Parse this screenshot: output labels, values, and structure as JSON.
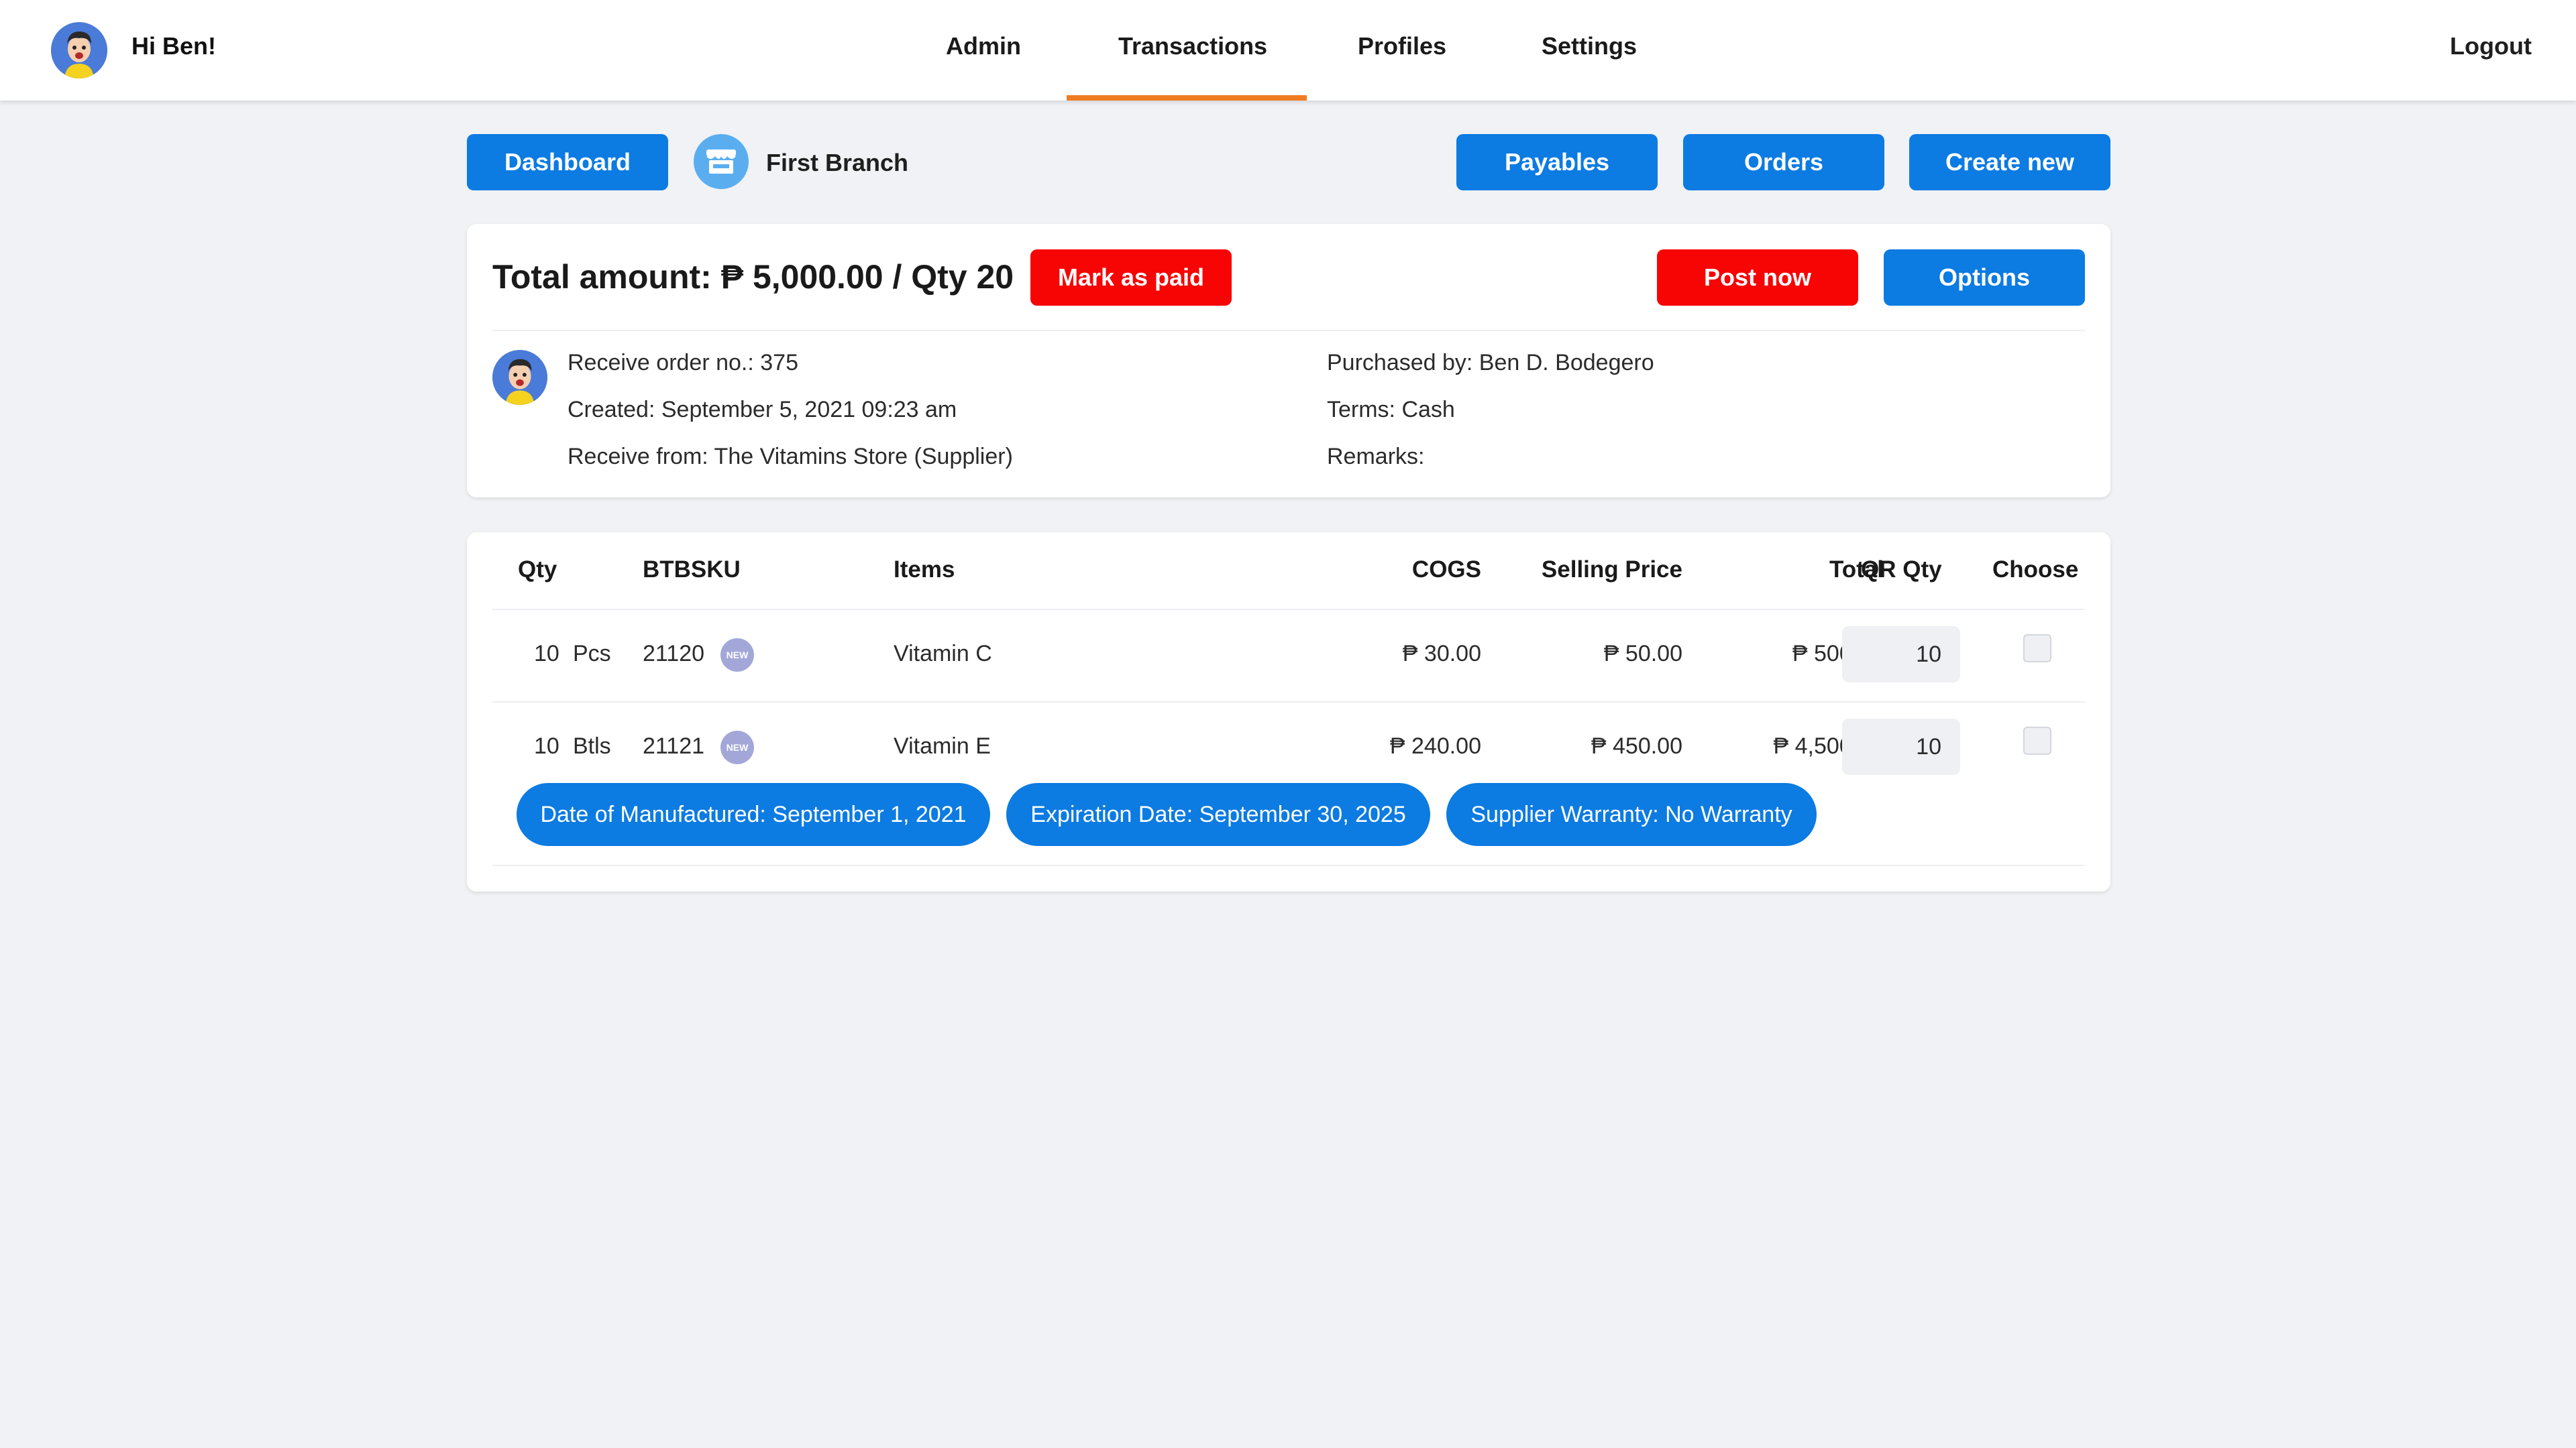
{
  "header": {
    "greeting": "Hi Ben!",
    "nav": [
      "Admin",
      "Transactions",
      "Profiles",
      "Settings"
    ],
    "active_nav": "Transactions",
    "logout": "Logout",
    "active_color": "#f07d22"
  },
  "toolbar": {
    "dashboard": "Dashboard",
    "branch": "First Branch",
    "payables": "Payables",
    "orders": "Orders",
    "create_new": "Create new"
  },
  "summary": {
    "total": "Total amount: ₱ 5,000.00 / Qty 20",
    "mark_paid": "Mark as paid",
    "post_now": "Post now",
    "options": "Options",
    "receive_order": "Receive order no.: 375",
    "created": "Created: September 5, 2021 09:23 am",
    "receive_from": "Receive from: The Vitamins Store (Supplier)",
    "purchased_by": "Purchased by: Ben D. Bodegero",
    "terms": "Terms: Cash",
    "remarks": "Remarks:"
  },
  "table": {
    "headers": [
      "Qty",
      "BTBSKU",
      "Items",
      "COGS",
      "Selling Price",
      "Total",
      "QR Qty",
      "Choose"
    ],
    "rows": [
      {
        "qty": "10",
        "unit": "Pcs",
        "sku": "21120",
        "badge": "NEW",
        "item": "Vitamin C",
        "cogs": "₱ 30.00",
        "price": "₱ 50.00",
        "total": "₱ 500.00",
        "qr_qty": "10"
      },
      {
        "qty": "10",
        "unit": "Btls",
        "sku": "21121",
        "badge": "NEW",
        "item": "Vitamin E",
        "cogs": "₱ 240.00",
        "price": "₱ 450.00",
        "total": "₱ 4,500.00",
        "qr_qty": "10"
      }
    ],
    "details": [
      "Date of Manufactured: September 1, 2021",
      "Expiration Date: September 30, 2025",
      "Supplier Warranty: No Warranty"
    ]
  },
  "colors": {
    "primary": "#0c7be2",
    "danger": "#f70405",
    "background": "#f0f2f5"
  }
}
